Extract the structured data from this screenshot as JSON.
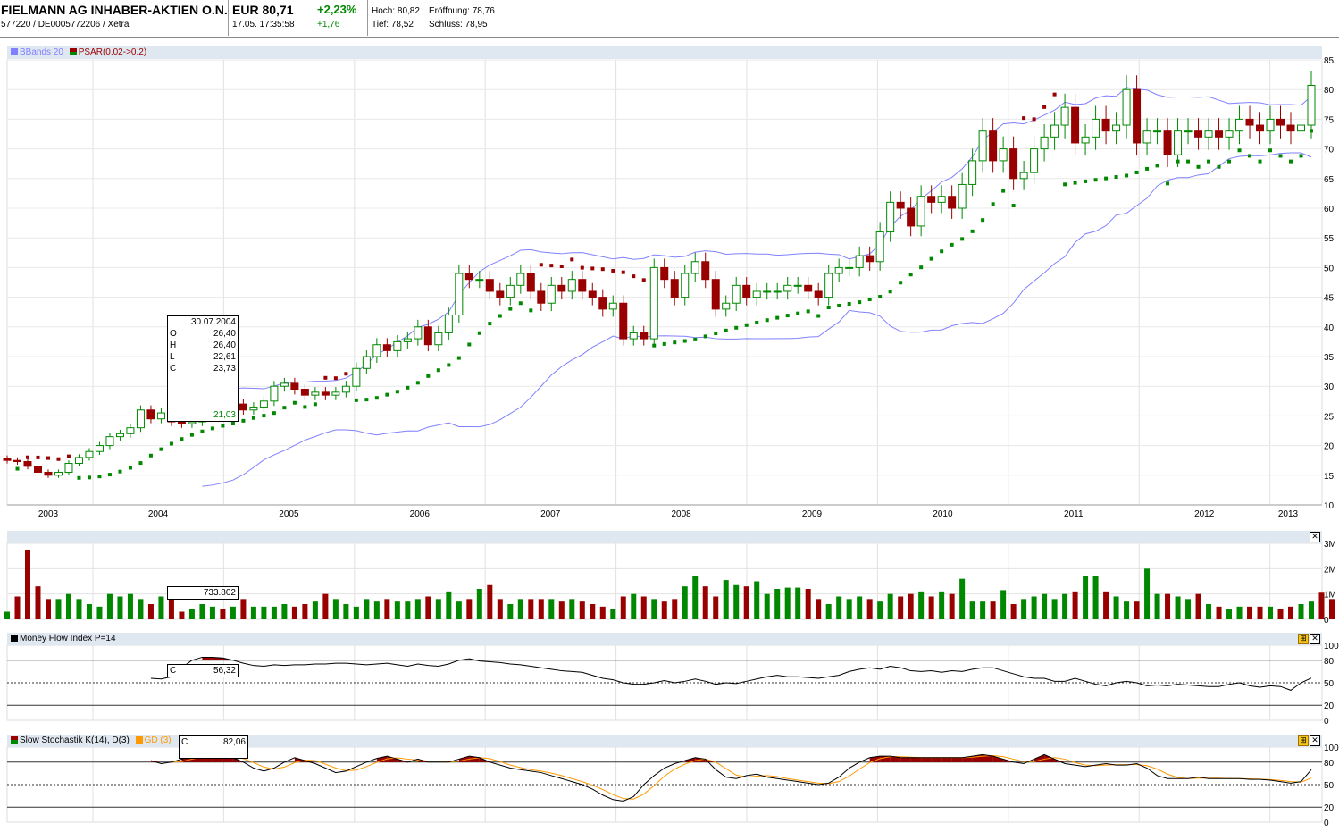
{
  "header": {
    "title": "FIELMANN AG INHABER-AKTIEN O.N.",
    "ids": "577220 / DE0005772206 / Xetra",
    "price": "EUR 80,71",
    "time": "17.05. 17:35:58",
    "change_pct": "+2,23%",
    "change_abs": "+1,76",
    "high": "Hoch: 80,82",
    "open": "Eröffnung: 78,76",
    "low": "Tief: 78,52",
    "close": "Schluss: 78,95"
  },
  "legends": {
    "bbands": "BBands 20",
    "psar": "PSAR(0.02->0.2)",
    "mfi": "Money Flow Index P=14",
    "stoch": "Slow Stochastik K(14), D(3)",
    "gd": "GD (3)"
  },
  "colors": {
    "up": "#008800",
    "down": "#990000",
    "bband": "#8080ff",
    "gd": "#ff9900",
    "accent_green": "#008800"
  },
  "tooltip": {
    "date": "30.07.2004",
    "rows": [
      [
        "O",
        "26,40"
      ],
      [
        "H",
        "26,40"
      ],
      [
        "L",
        "22,61"
      ],
      [
        "C",
        "23,73"
      ]
    ],
    "psar": "21,03",
    "volume": "733.802",
    "mfi": [
      "C",
      "56,32"
    ],
    "stoch": [
      "C",
      "82,06"
    ]
  },
  "chart_data": [
    {
      "type": "candlestick",
      "name": "price",
      "xlabels": [
        "2003",
        "2004",
        "2005",
        "2006",
        "2007",
        "2008",
        "2009",
        "2010",
        "2011",
        "2012",
        "2013"
      ],
      "yticks": [
        10,
        15,
        20,
        25,
        30,
        35,
        40,
        45,
        50,
        55,
        60,
        65,
        70,
        75,
        80,
        85
      ],
      "ylim": [
        10,
        85
      ],
      "grid": true,
      "close": [
        17.5,
        17.3,
        16.5,
        15.5,
        15,
        15.5,
        17,
        18,
        19,
        20,
        21.5,
        22,
        23,
        26,
        24.5,
        25.5,
        24,
        23.7,
        24,
        25,
        26,
        25.5,
        27,
        26,
        26.5,
        27.5,
        30,
        30.5,
        29.5,
        28.5,
        29,
        28.5,
        29,
        30,
        33,
        35,
        37,
        36,
        37.5,
        38,
        40,
        37,
        39,
        42,
        49,
        48,
        48,
        46,
        45,
        47,
        49,
        46,
        44,
        47,
        46,
        48,
        46,
        45,
        43,
        44,
        38,
        39,
        38,
        50,
        48,
        45,
        49,
        51,
        48,
        43,
        44,
        47,
        45,
        46,
        46,
        46,
        47,
        47,
        46,
        45,
        49,
        50,
        50,
        52,
        51,
        56,
        61,
        60,
        57,
        62,
        61,
        62,
        60,
        64,
        68,
        73,
        68,
        70,
        65,
        66,
        70,
        72,
        74,
        77,
        71,
        72,
        75,
        73,
        74,
        80,
        71,
        73,
        73,
        69,
        73,
        73,
        72,
        73,
        72,
        73,
        75,
        74,
        73,
        75,
        74,
        73,
        74,
        80.71
      ]
    },
    {
      "type": "bar",
      "name": "volume",
      "yticks": [
        "0",
        "1M",
        "2M",
        "3M"
      ],
      "ylim": [
        0,
        3
      ],
      "unit": "M",
      "values": [
        0.3,
        0.9,
        2.75,
        1.3,
        0.8,
        0.8,
        1.0,
        0.8,
        0.6,
        0.5,
        1.0,
        0.9,
        1.0,
        0.8,
        0.6,
        0.9,
        0.8,
        0.3,
        0.4,
        0.6,
        0.5,
        0.4,
        0.5,
        0.8,
        0.5,
        0.5,
        0.5,
        0.6,
        0.5,
        0.6,
        0.7,
        1.0,
        0.8,
        0.6,
        0.5,
        0.8,
        0.7,
        0.8,
        0.7,
        0.7,
        0.8,
        0.9,
        0.8,
        1.1,
        0.7,
        0.8,
        1.2,
        1.35,
        0.8,
        0.6,
        0.8,
        0.8,
        0.8,
        0.8,
        0.7,
        0.8,
        0.7,
        0.6,
        0.5,
        0.4,
        0.9,
        1.0,
        0.9,
        0.8,
        0.7,
        0.8,
        1.3,
        1.7,
        1.3,
        0.9,
        1.55,
        1.35,
        1.3,
        1.5,
        1.0,
        1.2,
        1.25,
        1.25,
        1.2,
        0.8,
        0.6,
        0.9,
        0.8,
        0.9,
        0.8,
        0.7,
        1.0,
        0.9,
        1.0,
        1.1,
        0.9,
        1.1,
        1.0,
        1.6,
        0.7,
        0.7,
        0.7,
        1.15,
        0.6,
        0.8,
        0.9,
        1.0,
        0.8,
        1.0,
        1.1,
        1.7,
        1.7,
        1.1,
        0.9,
        0.7,
        0.7,
        2.0,
        1.0,
        1.0,
        0.9,
        0.8,
        1.0,
        0.6,
        0.5,
        0.4,
        0.5,
        0.5,
        0.5,
        0.5,
        0.4,
        0.5,
        0.6,
        0.7,
        1.05,
        0.8,
        0.35
      ]
    },
    {
      "type": "line",
      "name": "mfi",
      "yticks": [
        0,
        20,
        50,
        80,
        100
      ],
      "ylim": [
        0,
        100
      ],
      "levels": [
        20,
        50,
        80
      ],
      "values": [
        null,
        null,
        null,
        null,
        null,
        null,
        null,
        null,
        null,
        null,
        null,
        null,
        null,
        null,
        56,
        55,
        58,
        70,
        80,
        84,
        84,
        83,
        80,
        76,
        73,
        72,
        74,
        73,
        74,
        74,
        75,
        75,
        76,
        76,
        75,
        74,
        75,
        76,
        74,
        72,
        75,
        73,
        72,
        75,
        80,
        82,
        79,
        78,
        77,
        75,
        74,
        72,
        70,
        68,
        66,
        65,
        64,
        60,
        56,
        54,
        50,
        48,
        48,
        50,
        53,
        50,
        52,
        55,
        52,
        48,
        50,
        49,
        52,
        55,
        58,
        60,
        58,
        58,
        57,
        56,
        58,
        60,
        65,
        68,
        70,
        68,
        72,
        70,
        66,
        65,
        66,
        64,
        66,
        65,
        68,
        70,
        70,
        66,
        62,
        58,
        56,
        56,
        52,
        52,
        56,
        52,
        48,
        46,
        50,
        52,
        50,
        46,
        47,
        46,
        48,
        47,
        46,
        45,
        45,
        48,
        50,
        46,
        44,
        46,
        45,
        40,
        50,
        56.32
      ]
    },
    {
      "type": "line",
      "name": "stochastic",
      "yticks": [
        0,
        20,
        50,
        80,
        100
      ],
      "ylim": [
        0,
        100
      ],
      "levels": [
        20,
        50,
        80
      ],
      "k": [
        null,
        null,
        null,
        null,
        null,
        null,
        null,
        null,
        null,
        null,
        null,
        null,
        null,
        null,
        82,
        78,
        80,
        84,
        88,
        88,
        88,
        88,
        86,
        80,
        72,
        68,
        72,
        80,
        86,
        82,
        78,
        72,
        66,
        68,
        74,
        80,
        85,
        88,
        84,
        80,
        84,
        80,
        80,
        80,
        84,
        88,
        86,
        80,
        76,
        72,
        70,
        68,
        66,
        62,
        58,
        54,
        50,
        44,
        36,
        30,
        28,
        34,
        50,
        62,
        72,
        78,
        82,
        86,
        84,
        70,
        60,
        58,
        62,
        64,
        60,
        58,
        56,
        54,
        52,
        50,
        52,
        60,
        72,
        80,
        86,
        88,
        88,
        86,
        86,
        86,
        86,
        86,
        86,
        86,
        88,
        90,
        88,
        84,
        80,
        78,
        84,
        90,
        84,
        78,
        76,
        74,
        76,
        78,
        76,
        76,
        78,
        72,
        62,
        58,
        58,
        58,
        60,
        58,
        58,
        58,
        58,
        57,
        57,
        56,
        54,
        52,
        54,
        70
      ]
    }
  ]
}
